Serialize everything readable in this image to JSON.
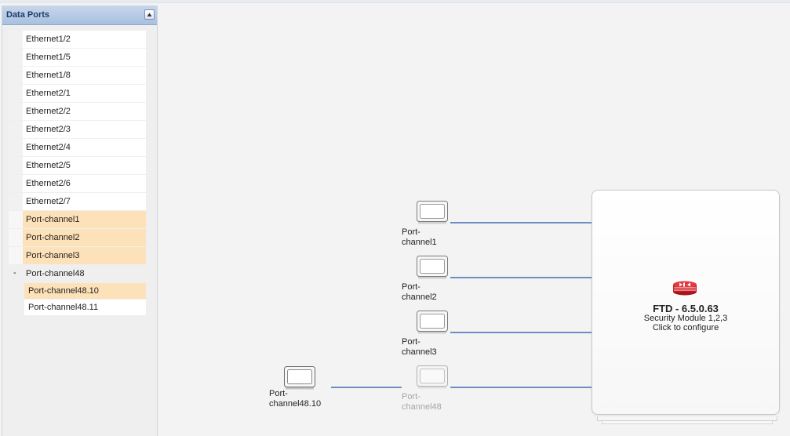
{
  "panel": {
    "title": "Data Ports",
    "ports": [
      {
        "label": "Ethernet1/2",
        "selected": false
      },
      {
        "label": "Ethernet1/5",
        "selected": false
      },
      {
        "label": "Ethernet1/8",
        "selected": false
      },
      {
        "label": "Ethernet2/1",
        "selected": false
      },
      {
        "label": "Ethernet2/2",
        "selected": false
      },
      {
        "label": "Ethernet2/3",
        "selected": false
      },
      {
        "label": "Ethernet2/4",
        "selected": false
      },
      {
        "label": "Ethernet2/5",
        "selected": false
      },
      {
        "label": "Ethernet2/6",
        "selected": false
      },
      {
        "label": "Ethernet2/7",
        "selected": false
      },
      {
        "label": "Port-channel1",
        "selected": true
      },
      {
        "label": "Port-channel2",
        "selected": true
      },
      {
        "label": "Port-channel3",
        "selected": true
      }
    ],
    "group": {
      "toggle": "-",
      "label": "Port-channel48",
      "children": [
        {
          "label": "Port-channel48.10",
          "selected": true
        },
        {
          "label": "Port-channel48.11",
          "selected": false
        }
      ]
    }
  },
  "canvas": {
    "nodes": {
      "pc1": {
        "line1": "Port-",
        "line2": "channel1"
      },
      "pc2": {
        "line1": "Port-",
        "line2": "channel2"
      },
      "pc3": {
        "line1": "Port-",
        "line2": "channel3"
      },
      "pc48": {
        "line1": "Port-",
        "line2": "channel48"
      },
      "pc4810": {
        "line1": "Port-",
        "line2": "channel48.10"
      }
    },
    "device": {
      "title": "FTD - 6.5.0.63",
      "subtitle": "Security Module 1,2,3",
      "action": "Click to configure",
      "logo_icon": "firewall-icon"
    }
  },
  "colors": {
    "link_line": "#6b8fc4",
    "selected_row": "#fde1b8",
    "header": "#a8c0e0"
  }
}
